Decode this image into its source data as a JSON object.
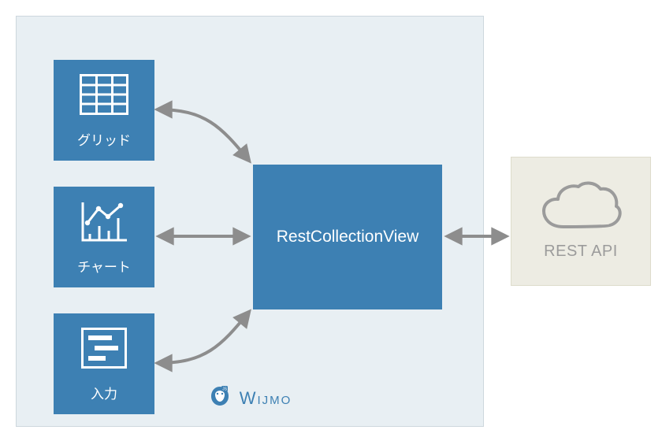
{
  "diagram": {
    "group_label": "Wijmo",
    "brand": "Wıjmo",
    "center_label": "RestCollectionView",
    "rest_api_label": "REST API",
    "components": {
      "grid": {
        "label": "グリッド"
      },
      "chart": {
        "label": "チャート"
      },
      "input": {
        "label": "入力"
      }
    },
    "connections": [
      {
        "from": "grid",
        "to": "RestCollectionView",
        "bidirectional": true
      },
      {
        "from": "chart",
        "to": "RestCollectionView",
        "bidirectional": true
      },
      {
        "from": "input",
        "to": "RestCollectionView",
        "bidirectional": true
      },
      {
        "from": "RestCollectionView",
        "to": "REST API",
        "bidirectional": true
      }
    ],
    "colors": {
      "box_fill": "#3d80b3",
      "group_fill": "#e8eff3",
      "rest_fill": "#edece3",
      "arrow": "#8d8d8d",
      "rest_text": "#9b9b9b"
    }
  }
}
